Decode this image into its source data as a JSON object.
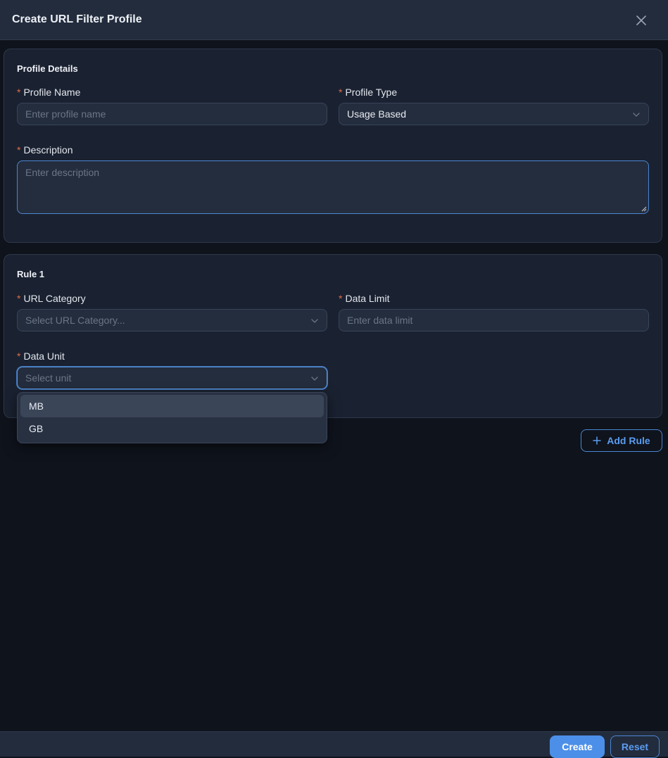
{
  "modal": {
    "title": "Create URL Filter Profile"
  },
  "profile_details": {
    "title": "Profile Details",
    "profile_name": {
      "label": "Profile Name",
      "placeholder": "Enter profile name",
      "value": ""
    },
    "profile_type": {
      "label": "Profile Type",
      "value": "Usage Based"
    },
    "description": {
      "label": "Description",
      "placeholder": "Enter description",
      "value": ""
    }
  },
  "rule": {
    "title": "Rule 1",
    "url_category": {
      "label": "URL Category",
      "placeholder": "Select URL Category..."
    },
    "data_limit": {
      "label": "Data Limit",
      "placeholder": "Enter data limit"
    },
    "data_unit": {
      "label": "Data Unit",
      "placeholder": "Select unit",
      "options": [
        "MB",
        "GB"
      ],
      "highlighted": "MB"
    }
  },
  "required_mark": "*",
  "add_rule": {
    "icon": "plus-icon",
    "label": "Add Rule"
  },
  "footer": {
    "create_label": "Create",
    "reset_label": "Reset"
  },
  "colors": {
    "accent": "#4c8fe8",
    "required": "#e06a4a",
    "background": "#0f131c"
  }
}
